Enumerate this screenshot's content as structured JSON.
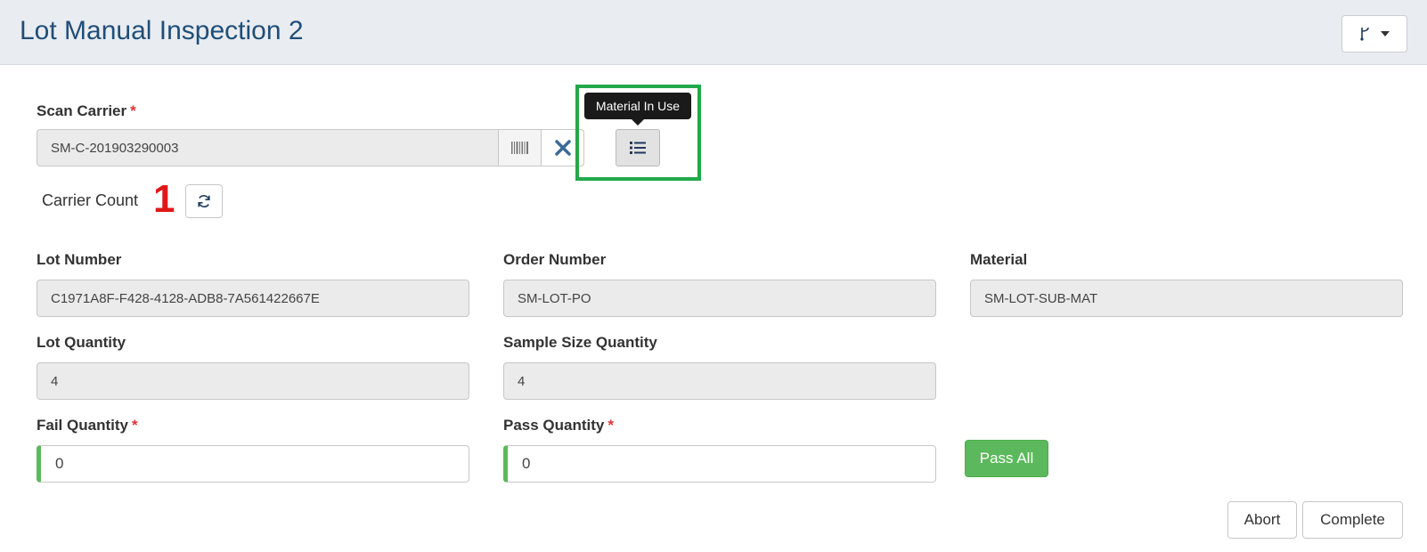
{
  "header": {
    "title": "Lot Manual Inspection 2",
    "menu_icon": "branch-icon"
  },
  "scan_carrier": {
    "label": "Scan Carrier",
    "required_mark": "*",
    "value": "SM-C-201903290003",
    "barcode_icon": "barcode-icon",
    "clear_icon": "close-icon"
  },
  "material_in_use": {
    "tooltip": "Material In Use",
    "icon": "list-icon",
    "highlight_color": "#22a84a"
  },
  "carrier_count": {
    "label": "Carrier Count",
    "value": "1",
    "refresh_icon": "refresh-icon"
  },
  "fields": {
    "lot_number": {
      "label": "Lot Number",
      "value": "C1971A8F-F428-4128-ADB8-7A561422667E"
    },
    "order_number": {
      "label": "Order Number",
      "value": "SM-LOT-PO"
    },
    "material": {
      "label": "Material",
      "value": "SM-LOT-SUB-MAT"
    },
    "lot_quantity": {
      "label": "Lot Quantity",
      "value": "4"
    },
    "sample_size_quantity": {
      "label": "Sample Size Quantity",
      "value": "4"
    },
    "fail_quantity": {
      "label": "Fail Quantity",
      "required_mark": "*",
      "value": "0"
    },
    "pass_quantity": {
      "label": "Pass Quantity",
      "required_mark": "*",
      "value": "0"
    }
  },
  "buttons": {
    "pass_all": "Pass All",
    "abort": "Abort",
    "complete": "Complete"
  },
  "colors": {
    "title": "#1f4e79",
    "required": "#e03131",
    "count": "#e01818",
    "success": "#5cb85c"
  }
}
